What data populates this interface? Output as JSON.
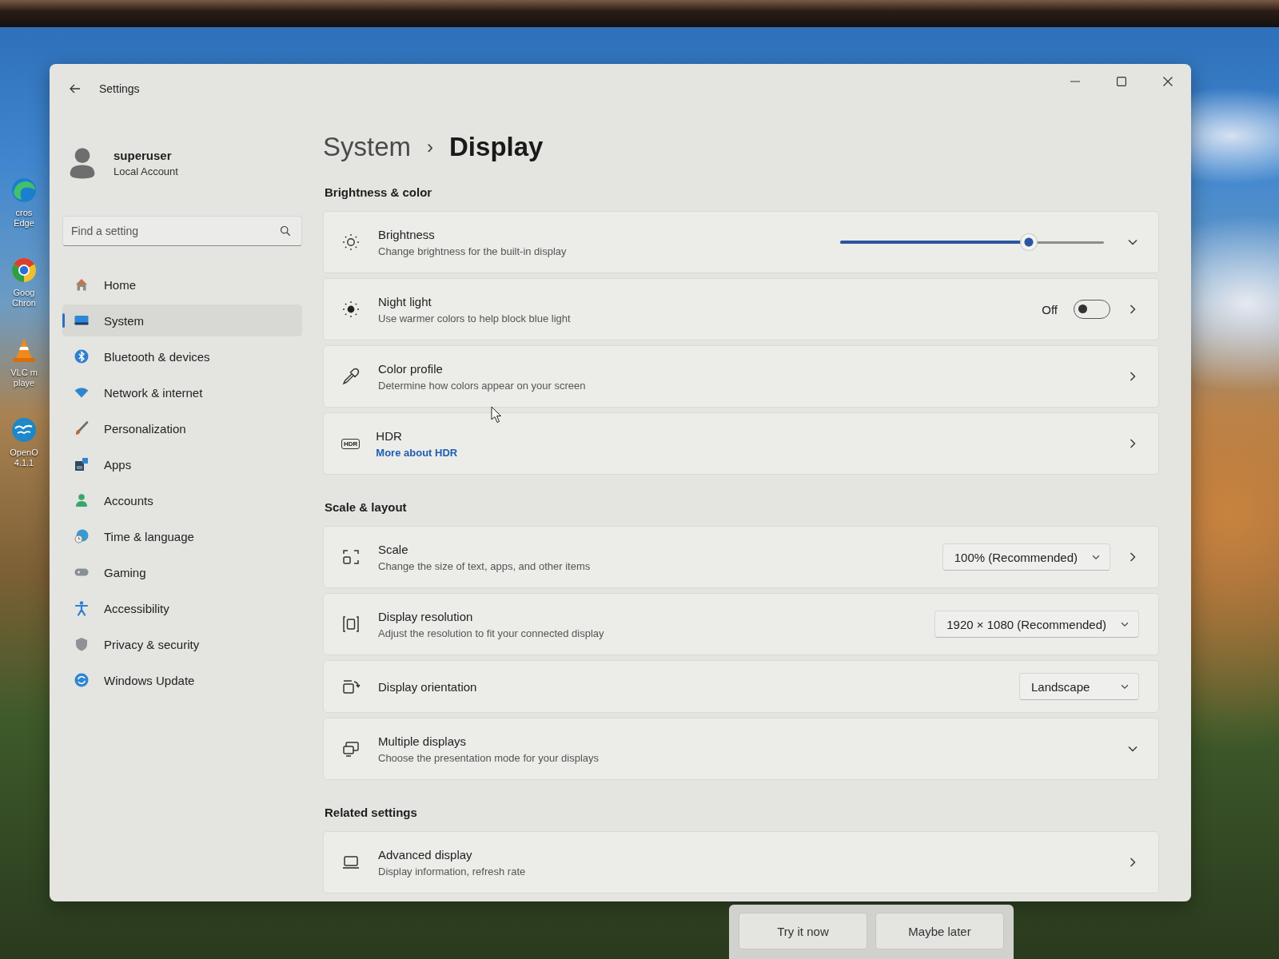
{
  "desktop_icons": [
    {
      "label_lines": [
        "cros",
        "Edge"
      ]
    },
    {
      "label_lines": [
        "Goog",
        "Chron"
      ]
    },
    {
      "label_lines": [
        "VLC m",
        "playe"
      ]
    },
    {
      "label_lines": [
        "OpenO",
        "4.1.1"
      ]
    }
  ],
  "window": {
    "title": "Settings"
  },
  "account": {
    "name": "superuser",
    "type": "Local Account"
  },
  "search": {
    "placeholder": "Find a setting"
  },
  "sidebar": {
    "items": [
      {
        "label": "Home",
        "selected": false
      },
      {
        "label": "System",
        "selected": true
      },
      {
        "label": "Bluetooth & devices",
        "selected": false
      },
      {
        "label": "Network & internet",
        "selected": false
      },
      {
        "label": "Personalization",
        "selected": false
      },
      {
        "label": "Apps",
        "selected": false
      },
      {
        "label": "Accounts",
        "selected": false
      },
      {
        "label": "Time & language",
        "selected": false
      },
      {
        "label": "Gaming",
        "selected": false
      },
      {
        "label": "Accessibility",
        "selected": false
      },
      {
        "label": "Privacy & security",
        "selected": false
      },
      {
        "label": "Windows Update",
        "selected": false
      }
    ]
  },
  "breadcrumb": {
    "parent": "System",
    "separator": "›",
    "current": "Display"
  },
  "sections": [
    {
      "title": "Brightness & color",
      "rows": [
        {
          "kind": "slider",
          "title": "Brightness",
          "subtitle": "Change brightness for the built-in display",
          "level": 0.73,
          "expanded": false
        },
        {
          "kind": "toggle",
          "title": "Night light",
          "subtitle": "Use warmer colors to help block blue light",
          "state_label": "Off",
          "on": false
        },
        {
          "kind": "link",
          "title": "Color profile",
          "subtitle": "Determine how colors appear on your screen"
        },
        {
          "kind": "link",
          "title": "HDR",
          "icon_label": "HDR",
          "link": "More about HDR"
        }
      ]
    },
    {
      "title": "Scale & layout",
      "rows": [
        {
          "kind": "select_link",
          "title": "Scale",
          "subtitle": "Change the size of text, apps, and other items",
          "value": "100% (Recommended)"
        },
        {
          "kind": "select",
          "title": "Display resolution",
          "subtitle": "Adjust the resolution to fit your connected display",
          "value": "1920 × 1080 (Recommended)"
        },
        {
          "kind": "select",
          "title": "Display orientation",
          "value": "Landscape"
        },
        {
          "kind": "expander",
          "title": "Multiple displays",
          "subtitle": "Choose the presentation mode for your displays",
          "expanded": false
        }
      ]
    },
    {
      "title": "Related settings",
      "rows": [
        {
          "kind": "link",
          "title": "Advanced display",
          "subtitle": "Display information, refresh rate"
        }
      ]
    }
  ],
  "toast": {
    "buttons": [
      "Try it now",
      "Maybe later"
    ]
  }
}
